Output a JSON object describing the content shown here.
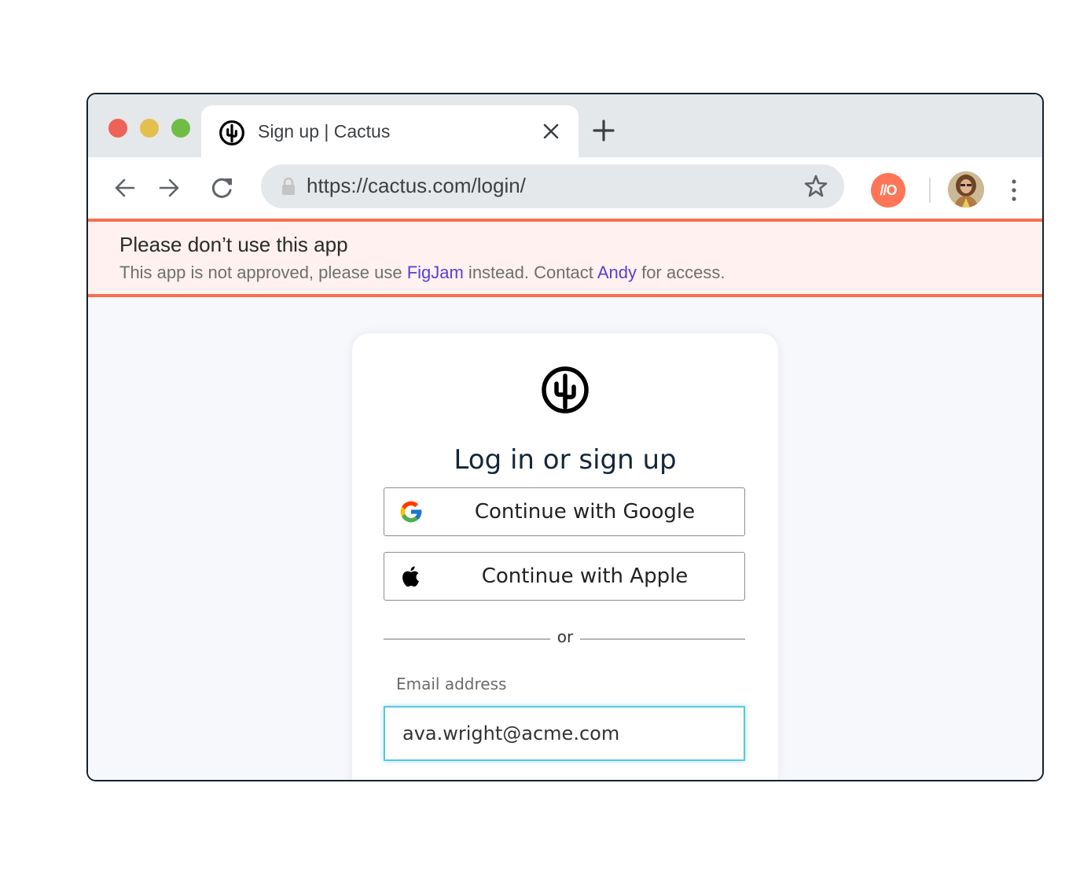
{
  "window": {
    "traffic_lights": {
      "close_color": "#ee6258",
      "minimize_color": "#e3c04e",
      "maximize_color": "#6fbd45"
    }
  },
  "tab": {
    "title": "Sign up | Cactus",
    "favicon": "cactus-logo-icon",
    "close_icon": "close-icon",
    "new_tab_icon": "plus-icon"
  },
  "toolbar": {
    "back_icon": "arrow-left-icon",
    "forward_icon": "arrow-right-icon",
    "reload_icon": "reload-icon",
    "url": "https://cactus.com/login/",
    "lock_icon": "lock-icon",
    "bookmark_icon": "star-icon",
    "extension_badge": "//O",
    "extension_color": "#ff7557",
    "avatar": "user-avatar",
    "menu_icon": "kebab-menu-icon"
  },
  "banner": {
    "title": "Please don’t use this app",
    "body_part1": "This app is not approved, please use ",
    "link1": "FigJam",
    "body_part2": " instead. Contact ",
    "link2": "Andy",
    "body_part3": " for access.",
    "accent_color": "#f5704f",
    "background_color": "#fff1ef",
    "link_color": "#5a3fd6"
  },
  "login_card": {
    "title": "Log in or sign up",
    "google_button": "Continue with Google",
    "apple_button": "Continue with Apple",
    "divider_text": "or",
    "email_label": "Email address",
    "email_value": "ava.wright@acme.com",
    "focus_color": "#56c8dc"
  }
}
